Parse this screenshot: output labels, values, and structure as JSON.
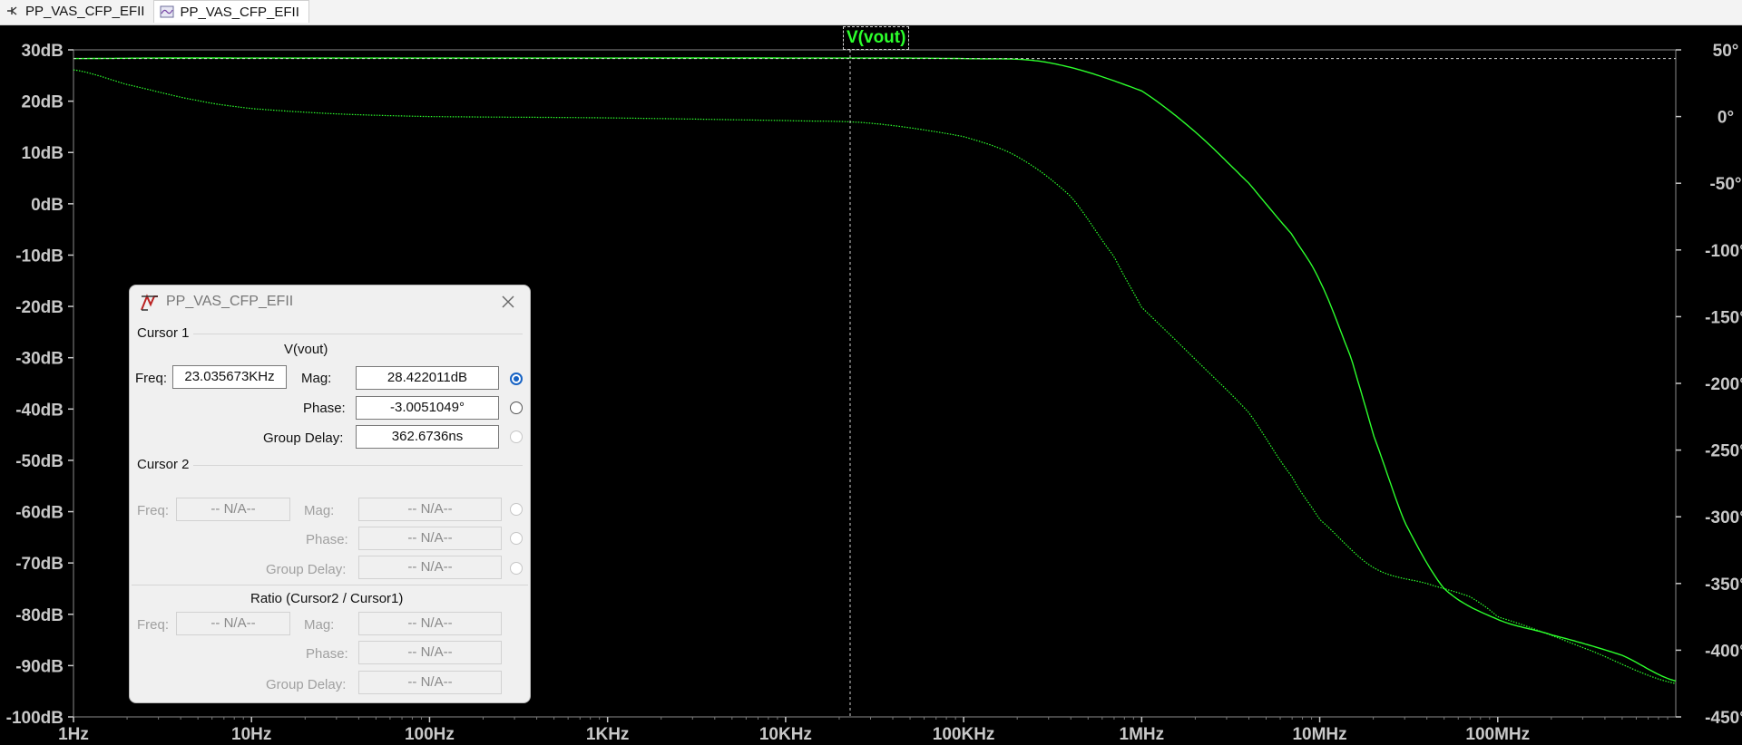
{
  "tabs": [
    {
      "label": "PP_VAS_CFP_EFII",
      "icon": "schematic-icon"
    },
    {
      "label": "PP_VAS_CFP_EFII",
      "icon": "waveform-icon"
    }
  ],
  "trace_label": "V(vout)",
  "colors": {
    "trace": "#2cff2c",
    "background": "#000000",
    "axis_text": "#c8c8c8"
  },
  "cursor_dialog": {
    "title": "PP_VAS_CFP_EFII",
    "cursor1": {
      "section": "Cursor 1",
      "trace": "V(vout)",
      "freq_label": "Freq:",
      "freq": "23.035673KHz",
      "mag_label": "Mag:",
      "mag": "28.422011dB",
      "phase_label": "Phase:",
      "phase": "-3.0051049°",
      "gd_label": "Group Delay:",
      "gd": "362.6736ns"
    },
    "cursor2": {
      "section": "Cursor 2",
      "freq_label": "Freq:",
      "freq": "-- N/A--",
      "mag_label": "Mag:",
      "mag": "-- N/A--",
      "phase_label": "Phase:",
      "phase": "-- N/A--",
      "gd_label": "Group Delay:",
      "gd": "-- N/A--"
    },
    "ratio": {
      "section": "Ratio (Cursor2 / Cursor1)",
      "freq_label": "Freq:",
      "freq": "-- N/A--",
      "mag_label": "Mag:",
      "mag": "-- N/A--",
      "phase_label": "Phase:",
      "phase": "-- N/A--",
      "gd_label": "Group Delay:",
      "gd": "-- N/A--"
    }
  },
  "chart_data": {
    "type": "line",
    "x_scale": "log",
    "xlim": [
      1,
      1000000000
    ],
    "ylim_left": [
      -100,
      30
    ],
    "ylim_right": [
      -450,
      50
    ],
    "x_ticks": [
      "1Hz",
      "10Hz",
      "100Hz",
      "1KHz",
      "10KHz",
      "100KHz",
      "1MHz",
      "10MHz",
      "100MHz"
    ],
    "x_tick_values": [
      1,
      10,
      100,
      1000,
      10000,
      100000,
      1000000,
      10000000,
      100000000
    ],
    "y_left_ticks": [
      "30dB",
      "20dB",
      "10dB",
      "0dB",
      "-10dB",
      "-20dB",
      "-30dB",
      "-40dB",
      "-50dB",
      "-60dB",
      "-70dB",
      "-80dB",
      "-90dB",
      "-100dB"
    ],
    "y_left_values": [
      30,
      20,
      10,
      0,
      -10,
      -20,
      -30,
      -40,
      -50,
      -60,
      -70,
      -80,
      -90,
      -100
    ],
    "y_right_ticks": [
      "50°",
      "0°",
      "-50°",
      "-100°",
      "-150°",
      "-200°",
      "-250°",
      "-300°",
      "-350°",
      "-400°",
      "-450°"
    ],
    "y_right_values": [
      50,
      0,
      -50,
      -100,
      -150,
      -200,
      -250,
      -300,
      -350,
      -400,
      -450
    ],
    "cursor_x": 23035.673,
    "series": [
      {
        "name": "V(vout)",
        "axis": "left",
        "style": "solid",
        "x": [
          1,
          3,
          10,
          100,
          1000,
          10000,
          100000,
          300000,
          1000000,
          2000000,
          4000000,
          7000000,
          10000000,
          15000000,
          20000000,
          30000000,
          50000000,
          100000000,
          200000000,
          500000000,
          1000000000
        ],
        "y": [
          28.3,
          28.4,
          28.4,
          28.4,
          28.4,
          28.4,
          28.3,
          27.5,
          22.0,
          14.0,
          4.0,
          -6.0,
          -15.0,
          -30.0,
          -45.0,
          -62.0,
          -75.0,
          -81.0,
          -84.0,
          -88.0,
          -93.0
        ]
      },
      {
        "name": "V(vout)",
        "axis": "right",
        "style": "dotted",
        "x": [
          1,
          2,
          5,
          10,
          30,
          100,
          1000,
          10000,
          30000,
          100000,
          200000,
          400000,
          700000,
          1000000,
          2000000,
          4000000,
          7000000,
          10000000,
          20000000,
          40000000,
          70000000,
          100000000,
          300000000,
          1000000000
        ],
        "y": [
          35,
          24,
          12,
          6,
          2,
          0,
          -1,
          -3,
          -5,
          -15,
          -30,
          -60,
          -105,
          -143,
          -182,
          -222,
          -270,
          -302,
          -338,
          -350,
          -360,
          -375,
          -398,
          -425
        ]
      }
    ]
  }
}
